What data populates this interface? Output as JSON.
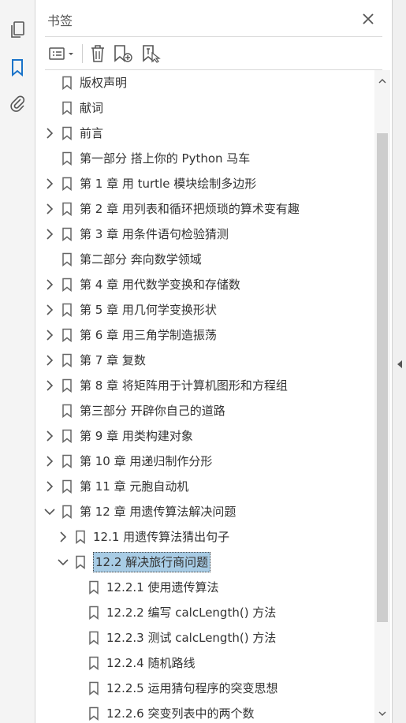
{
  "panel": {
    "title": "书签"
  },
  "left_tools": [
    {
      "icon": "pages-icon"
    },
    {
      "icon": "bookmark-icon",
      "active": true
    },
    {
      "icon": "paperclip-icon"
    }
  ],
  "toolbar": [
    {
      "icon": "options-menu-icon"
    },
    {
      "icon": "delete-icon"
    },
    {
      "icon": "new-bookmark-icon"
    },
    {
      "icon": "bookmark-from-selection-icon"
    }
  ],
  "colors": {
    "accent_blue": "#1a73c9",
    "selection": "#a8cce5"
  },
  "bookmarks": [
    {
      "label": "版权声明",
      "level": 0,
      "expander": "none"
    },
    {
      "label": "献词",
      "level": 0,
      "expander": "none"
    },
    {
      "label": "前言",
      "level": 0,
      "expander": "collapsed"
    },
    {
      "label": "第一部分 搭上你的 Python 马车",
      "level": 0,
      "expander": "none"
    },
    {
      "label": "第 1 章 用 turtle 模块绘制多边形",
      "level": 0,
      "expander": "collapsed"
    },
    {
      "label": "第 2 章 用列表和循环把烦琐的算术变有趣",
      "level": 0,
      "expander": "collapsed"
    },
    {
      "label": "第 3 章 用条件语句检验猜测",
      "level": 0,
      "expander": "collapsed"
    },
    {
      "label": "第二部分 奔向数学领域",
      "level": 0,
      "expander": "none"
    },
    {
      "label": "第 4 章 用代数学变换和存储数",
      "level": 0,
      "expander": "collapsed"
    },
    {
      "label": "第 5 章 用几何学变换形状",
      "level": 0,
      "expander": "collapsed"
    },
    {
      "label": "第 6 章 用三角学制造振荡",
      "level": 0,
      "expander": "collapsed"
    },
    {
      "label": "第 7 章 复数",
      "level": 0,
      "expander": "collapsed"
    },
    {
      "label": "第 8 章 将矩阵用于计算机图形和方程组",
      "level": 0,
      "expander": "collapsed"
    },
    {
      "label": "第三部分 开辟你自己的道路",
      "level": 0,
      "expander": "none"
    },
    {
      "label": "第 9 章 用类构建对象",
      "level": 0,
      "expander": "collapsed"
    },
    {
      "label": "第 10 章 用递归制作分形",
      "level": 0,
      "expander": "collapsed"
    },
    {
      "label": "第 11 章 元胞自动机",
      "level": 0,
      "expander": "collapsed"
    },
    {
      "label": "第 12 章 用遗传算法解决问题",
      "level": 0,
      "expander": "expanded"
    },
    {
      "label": "12.1 用遗传算法猜出句子",
      "level": 1,
      "expander": "collapsed"
    },
    {
      "label": "12.2 解决旅行商问题",
      "level": 1,
      "expander": "expanded",
      "selected": true
    },
    {
      "label": "12.2.1 使用遗传算法",
      "level": 2,
      "expander": "none"
    },
    {
      "label": "12.2.2 编写 calcLength() 方法",
      "level": 2,
      "expander": "none"
    },
    {
      "label": "12.2.3 测试 calcLength() 方法",
      "level": 2,
      "expander": "none"
    },
    {
      "label": "12.2.4 随机路线",
      "level": 2,
      "expander": "none"
    },
    {
      "label": "12.2.5 运用猜句程序的突变思想",
      "level": 2,
      "expander": "none"
    },
    {
      "label": "12.2.6 突变列表中的两个数",
      "level": 2,
      "expander": "none"
    }
  ]
}
